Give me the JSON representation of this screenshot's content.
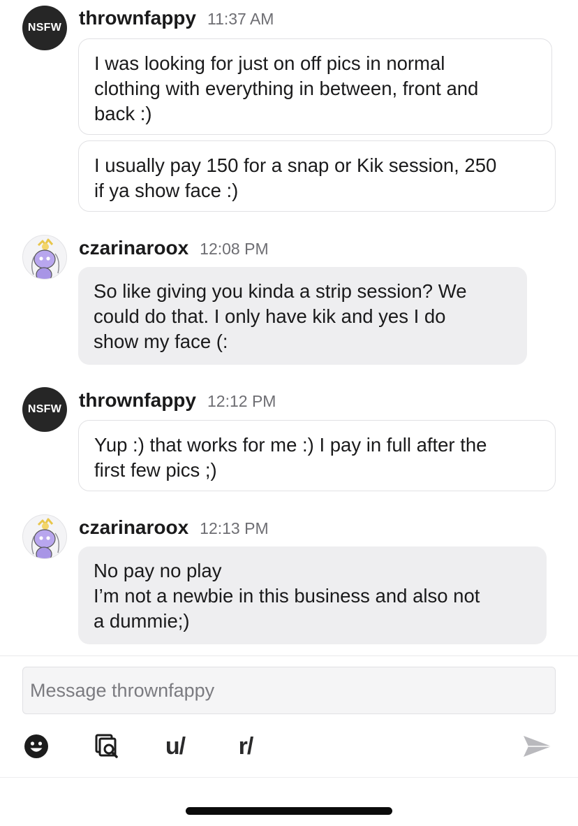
{
  "messages": [
    {
      "user": "thrownfappy",
      "time": "11:37 AM",
      "avatar_type": "nsfw",
      "avatar_label": "NSFW",
      "bubbles": [
        "I was looking for just on off pics in normal\nclothing with everything in between, front and\nback :)",
        "I usually pay 150 for a snap or Kik session, 250\nif ya show face :)"
      ]
    },
    {
      "user": "czarinaroox",
      "time": "12:08 PM",
      "avatar_type": "snoo",
      "bubbles": [
        "So like giving you kinda a strip session? We\ncould do that. I only have kik and yes I do\nshow my face (:"
      ]
    },
    {
      "user": "thrownfappy",
      "time": "12:12 PM",
      "avatar_type": "nsfw",
      "avatar_label": "NSFW",
      "bubbles": [
        "Yup :) that works for me :) I pay in full after the\nfirst few pics ;)"
      ]
    },
    {
      "user": "czarinaroox",
      "time": "12:13 PM",
      "avatar_type": "snoo",
      "bubbles": [
        "No pay no play\nI’m not a newbie in this business and also not\na dummie;)"
      ]
    }
  ],
  "composer": {
    "placeholder": "Message thrownfappy",
    "tools": {
      "emoji_icon": "emoji-icon",
      "gallery_icon": "gallery-search-icon",
      "user_mention": "u/",
      "subreddit_mention": "r/",
      "send_icon": "send-icon"
    }
  },
  "colors": {
    "incoming_bubble": "#eeeef0",
    "outgoing_border": "#e1e1e4",
    "nsfw_avatar": "#262626",
    "send_disabled": "#b9b9bd"
  }
}
